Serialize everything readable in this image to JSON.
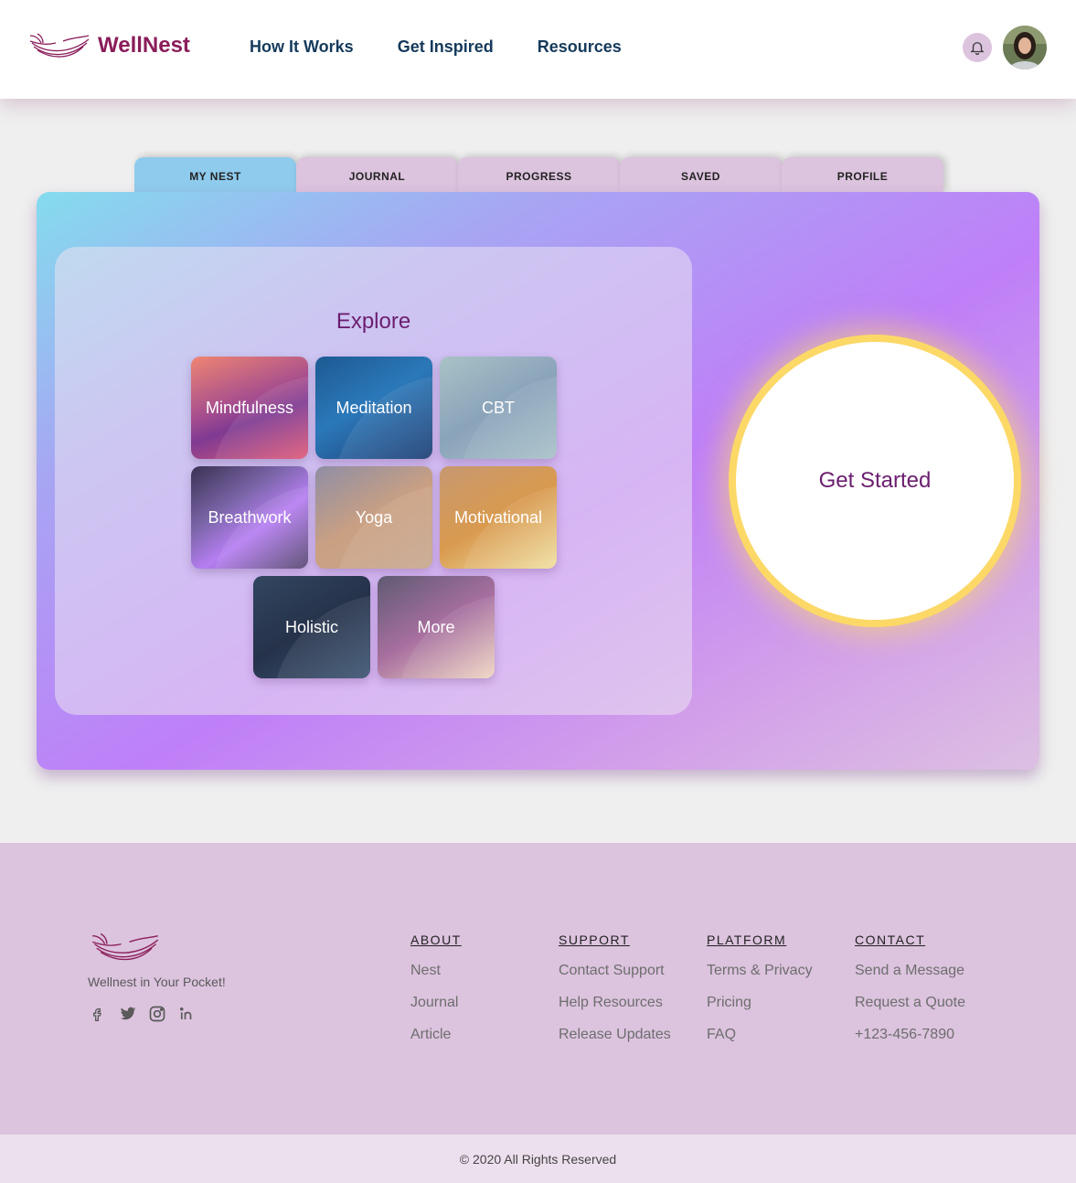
{
  "header": {
    "brand": "WellNest",
    "nav": [
      "How It Works",
      "Get Inspired",
      "Resources"
    ],
    "bell_icon": "bell-icon",
    "avatar_icon": "user-avatar"
  },
  "tabs": [
    "MY NEST",
    "JOURNAL",
    "PROGRESS",
    "SAVED",
    "PROFILE"
  ],
  "active_tab": "MY NEST",
  "explore": {
    "title": "Explore",
    "tiles": [
      "Mindfulness",
      "Meditation",
      "CBT",
      "Breathwork",
      "Yoga",
      "Motivational",
      "Holistic",
      "More"
    ]
  },
  "cta": {
    "label": "Get Started"
  },
  "footer": {
    "tagline": "Wellnest in Your Pocket!",
    "socials": [
      "facebook-icon",
      "twitter-icon",
      "instagram-icon",
      "linkedin-icon"
    ],
    "columns": [
      {
        "heading": "ABOUT",
        "links": [
          "Nest",
          "Journal",
          "Article"
        ]
      },
      {
        "heading": "SUPPORT",
        "links": [
          "Contact Support",
          "Help Resources",
          "Release Updates"
        ]
      },
      {
        "heading": "PLATFORM",
        "links": [
          "Terms & Privacy",
          "Pricing",
          "FAQ"
        ]
      },
      {
        "heading": "CONTACT",
        "links": [
          "Send a Message",
          "Request a Quote",
          "+123-456-7890"
        ]
      }
    ],
    "copyright": "© 2020 All Rights Reserved"
  },
  "colors": {
    "brand": "#8a1d5a",
    "nav": "#153a5b",
    "tab": "#dcc3de",
    "tab_active": "#8fcbed",
    "accent": "#6b1e6f",
    "glow": "#fcd867"
  }
}
